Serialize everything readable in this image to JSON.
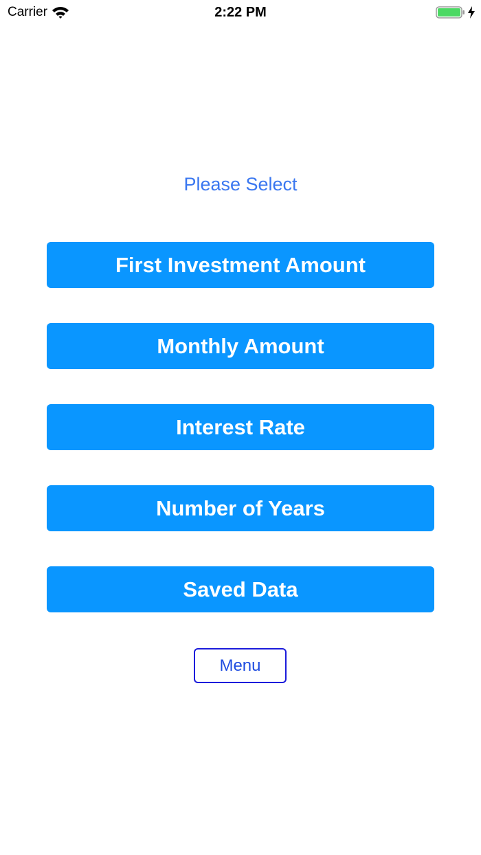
{
  "status_bar": {
    "carrier": "Carrier",
    "time": "2:22 PM",
    "wifi_icon": "wifi-icon",
    "battery_icon": "battery-icon",
    "charging_icon": "bolt-icon",
    "battery_color": "#4cd964"
  },
  "main": {
    "prompt": "Please Select",
    "buttons": [
      "First Investment Amount",
      "Monthly Amount",
      "Interest Rate",
      "Number of Years",
      "Saved Data"
    ],
    "menu_label": "Menu"
  },
  "colors": {
    "button_fill": "#0a96ff",
    "prompt_text": "#3a77f0",
    "menu_border": "#1a1adb"
  }
}
